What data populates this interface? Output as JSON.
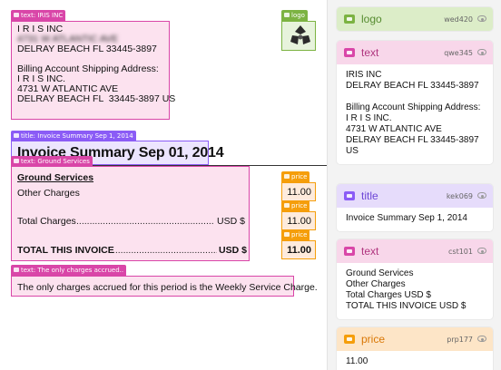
{
  "document": {
    "address_block": {
      "tag": "text: IRIS INC",
      "lines_clear": [
        "I R I S INC",
        "DELRAY BEACH FL 33445-3897",
        "",
        "Billing Account Shipping Address:",
        "I R I S INC.",
        "4731 W ATLANTIC AVE",
        "DELRAY BEACH FL  33445-3897 US"
      ],
      "redacted_line": "4731 W ATLANTIC AVE"
    },
    "logo": {
      "tag": "logo"
    },
    "title": {
      "tag": "title: Invoice Summary Sep 1, 2014",
      "text": "Invoice Summary Sep 01, 2014"
    },
    "charges": {
      "tag": "text: Ground Services",
      "ground_services": "Ground Services",
      "other_charges": "Other Charges",
      "total_charges": "Total Charges",
      "total_charges_unit": "USD $",
      "total_invoice": "TOTAL THIS INVOICE",
      "total_invoice_unit": "USD $"
    },
    "prices": [
      {
        "tag": "price",
        "value": "11.00"
      },
      {
        "tag": "price",
        "value": "11.00"
      },
      {
        "tag": "price",
        "value": "11.00"
      }
    ],
    "note": {
      "tag": "text: The only charges accrued..",
      "text": "The only charges accrued for this period is the Weekly Service Charge."
    }
  },
  "panel": {
    "cards": [
      {
        "type": "logo",
        "id": "wed420",
        "body": ""
      },
      {
        "type": "text",
        "id": "qwe345",
        "body": "IRIS INC\nDELRAY BEACH FL 33445-3897\n\nBilling Account Shipping Address:\nI R I S INC.\n4731 W ATLANTIC AVE\nDELRAY BEACH FL 33445-3897 US"
      },
      {
        "type": "title",
        "id": "kek069",
        "body": "Invoice Summary Sep 1, 2014"
      },
      {
        "type": "text",
        "id": "cst101",
        "body": "Ground Services\nOther Charges\nTotal Charges USD $\nTOTAL THIS INVOICE USD $"
      },
      {
        "type": "price",
        "id": "prp177",
        "body": "11.00"
      }
    ]
  },
  "colors": {
    "text": "#d946a8",
    "logo": "#7cb342",
    "title": "#8b5cf6",
    "price": "#f59e0b"
  }
}
